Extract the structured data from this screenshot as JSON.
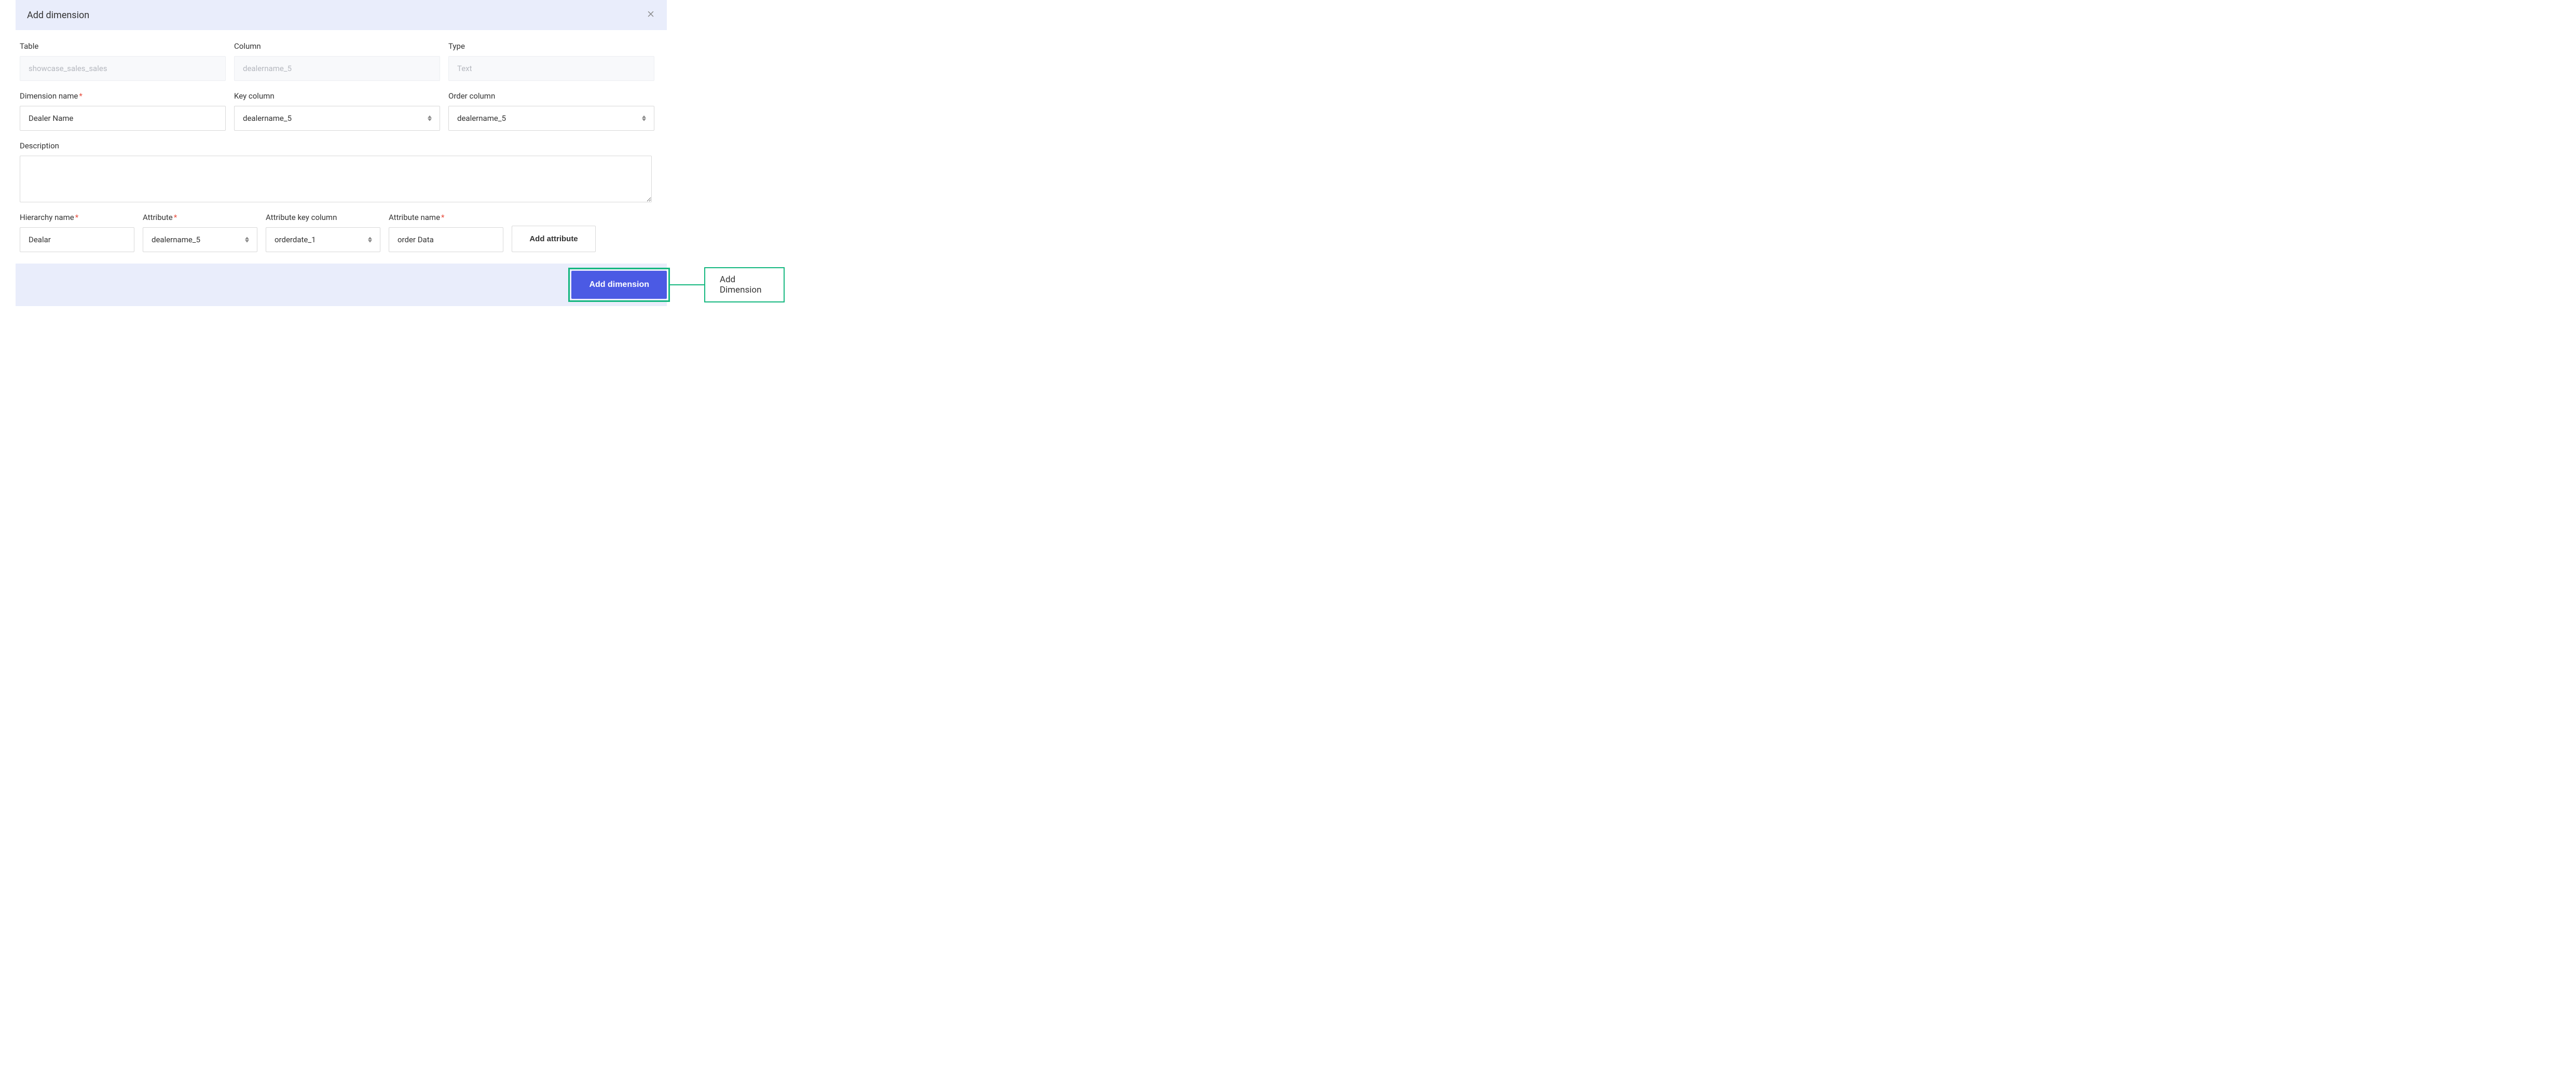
{
  "dialog": {
    "title": "Add dimension"
  },
  "fields": {
    "table": {
      "label": "Table",
      "value": "showcase_sales_sales"
    },
    "column": {
      "label": "Column",
      "value": "dealername_5"
    },
    "type": {
      "label": "Type",
      "value": "Text"
    },
    "dimension_name": {
      "label": "Dimension name",
      "value": "Dealer Name"
    },
    "key_column": {
      "label": "Key column",
      "value": "dealername_5"
    },
    "order_column": {
      "label": "Order column",
      "value": "dealername_5"
    },
    "description": {
      "label": "Description",
      "value": ""
    },
    "hierarchy_name": {
      "label": "Hierarchy name",
      "value": "Dealar"
    },
    "attribute": {
      "label": "Attribute",
      "value": "dealername_5"
    },
    "attribute_key_column": {
      "label": "Attribute key column",
      "value": "orderdate_1"
    },
    "attribute_name": {
      "label": "Attribute name",
      "value": "order Data"
    }
  },
  "buttons": {
    "add_attribute": "Add attribute",
    "add_dimension": "Add dimension"
  },
  "callout": {
    "label": "Add Dimension"
  }
}
